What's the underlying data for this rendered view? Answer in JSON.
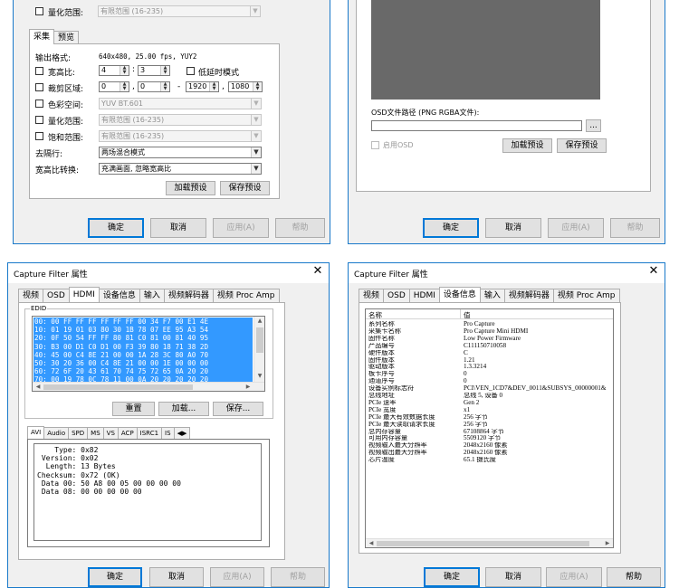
{
  "colors": {
    "selection": "#3399ff",
    "window_border": "#1979ca",
    "dark_preview": "#696969"
  },
  "common": {
    "ok": "确定",
    "cancel": "取消",
    "apply": "应用(A)",
    "help": "帮助",
    "title": "Capture Filter 属性",
    "close_glyph": "✕"
  },
  "top_left": {
    "quant_range": {
      "label": "量化范围:",
      "value": "有限范围 (16-235)"
    },
    "tabs": [
      "采集",
      "预览"
    ],
    "output_format": {
      "label": "输出格式:",
      "value": "640x480, 25.00 fps, YUY2"
    },
    "aspect": {
      "label": "宽高比:",
      "w": "4",
      "h": "3",
      "sep": ":"
    },
    "low_latency": "低延时模式",
    "crop": {
      "label": "裁剪区域:",
      "v1": "0",
      "v2": "0",
      "v3": "1920",
      "v4": "1080",
      "comma": ",",
      "dash": "-"
    },
    "colorspace": {
      "label": "色彩空间:",
      "value": "YUV BT.601"
    },
    "quant2": {
      "label": "量化范围:",
      "value": "有限范围 (16-235)"
    },
    "saturation": {
      "label": "饱和范围:",
      "value": "有限范围 (16-235)"
    },
    "deinterlace": {
      "label": "去隔行:",
      "value": "两场混合模式"
    },
    "aspect_convert": {
      "label": "宽高比转换:",
      "value": "充满画面, 忽略宽高比"
    },
    "load_preset": "加载预设",
    "save_preset": "保存预设"
  },
  "top_right": {
    "osd_path_label": "OSD文件路径 (PNG RGBA文件):",
    "browse": "...",
    "enable_osd": "启用OSD",
    "load_preset": "加载预设",
    "save_preset": "保存预设"
  },
  "bottom_left": {
    "tabs": [
      "视频",
      "OSD",
      "HDMI",
      "设备信息",
      "输入",
      "视频解码器",
      "视频 Proc Amp"
    ],
    "active_tab": 2,
    "edid_label": "EDID",
    "hex_rows": [
      "00: 00 FF FF FF FF FF FF 00 34 F7 00 E1 4E",
      "10: 01 19 01 03 80 30 1B 78 07 EE 95 A3 54",
      "20: 0F 50 54 FF FF 80 81 C0 81 00 81 40 95",
      "30: B3 00 D1 C0 D1 00 F3 39 80 18 71 38 2D",
      "40: 45 00 C4 8E 21 00 00 1A 28 3C 80 A0 70",
      "50: 30 20 36 00 C4 8E 21 00 00 1E 00 00 00",
      "60: 72 6F 20 43 61 70 74 75 72 65 0A 20 20",
      "70: 00 19 78 0C 78 11 00 0A 20 20 20 20 20"
    ],
    "reset": "重置",
    "load": "加载...",
    "save": "保存...",
    "info_tabs": [
      "AVI",
      "Audio",
      "SPD",
      "MS",
      "VS",
      "ACP",
      "ISRC1",
      "IS"
    ],
    "info_lines": [
      "    Type: 0x82",
      " Version: 0x02",
      "  Length: 13 Bytes",
      "Checksum: 0x72 (OK)",
      " Data 00: 50 A8 00 05 00 00 00 00",
      " Data 08: 00 00 00 00 00"
    ]
  },
  "bottom_right": {
    "tabs": [
      "视频",
      "OSD",
      "HDMI",
      "设备信息",
      "输入",
      "视频解码器",
      "视频 Proc Amp"
    ],
    "active_tab": 3,
    "col_name": "名称",
    "col_value": "值",
    "rows": [
      [
        "系列名称",
        "Pro Capture"
      ],
      [
        "采集卡名称",
        "Pro Capture Mini HDMI"
      ],
      [
        "固件名称",
        "Low Power Firmware"
      ],
      [
        "产品编号",
        "C111150710058"
      ],
      [
        "硬件版本",
        "C"
      ],
      [
        "固件版本",
        "1.21"
      ],
      [
        "驱动版本",
        "1.3.3214"
      ],
      [
        "板卡序号",
        "0"
      ],
      [
        "通道序号",
        "0"
      ],
      [
        "设备实例标志符",
        "PCI\\VEN_1CD7&DEV_0011&SUBSYS_00000001&"
      ],
      [
        "总线地址",
        "总线 5, 设备 0"
      ],
      [
        "PCIe 速率",
        "Gen 2"
      ],
      [
        "PCIe 宽度",
        "x1"
      ],
      [
        "PCIe 最大有效数据长度",
        "256 字节"
      ],
      [
        "PCIe 最大读取请求长度",
        "256 字节"
      ],
      [
        "总内存容量",
        "67108864 字节"
      ],
      [
        "可用内存容量",
        "5509120 字节"
      ],
      [
        "视频输入最大分辨率",
        "2048x2160 像素"
      ],
      [
        "视频输出最大分辨率",
        "2048x2160 像素"
      ],
      [
        "芯片温度",
        "65.1 摄氏度"
      ]
    ]
  }
}
